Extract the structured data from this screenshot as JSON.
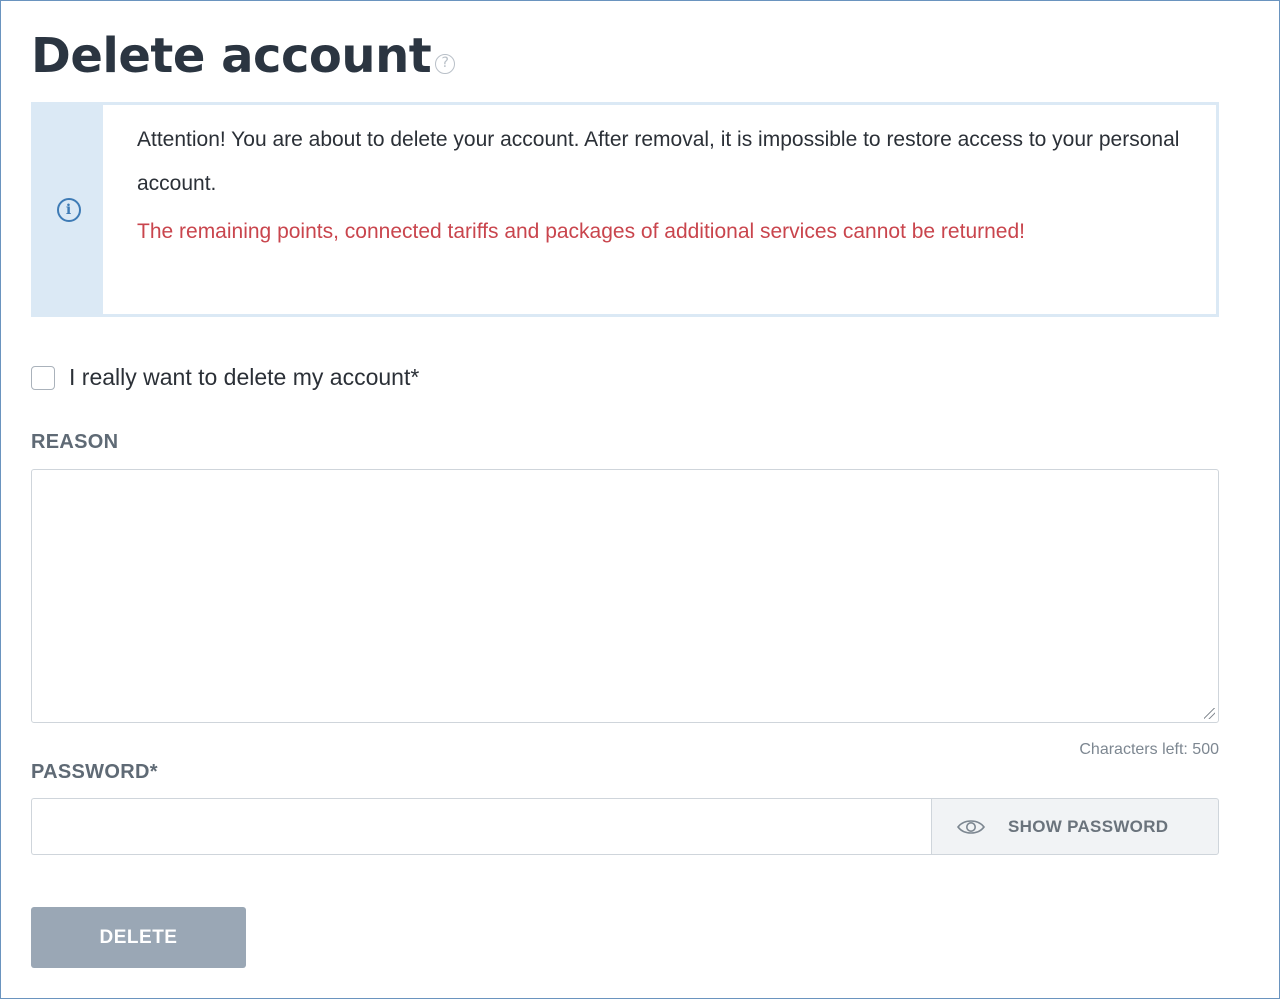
{
  "header": {
    "title": "Delete account",
    "help_icon_glyph": "?"
  },
  "alert": {
    "icon": "info-icon",
    "icon_glyph": "i",
    "text": "Attention! You are about to delete your account. After removal, it is impossible to restore access to your personal account.",
    "warning": "The remaining points, connected tariffs and packages of additional services cannot be returned!",
    "warning_color": "#c9454d",
    "background_color": "#dbe9f5"
  },
  "confirm": {
    "label": "I really want to delete my account*",
    "checked": false
  },
  "reason": {
    "label": "REASON",
    "value": "",
    "chars_left": "Characters left: 500"
  },
  "password": {
    "label": "PASSWORD*",
    "value": "",
    "show_label": "SHOW PASSWORD",
    "show_icon": "eye-icon"
  },
  "actions": {
    "delete_label": "DELETE",
    "delete_color": "#9aa7b5"
  }
}
